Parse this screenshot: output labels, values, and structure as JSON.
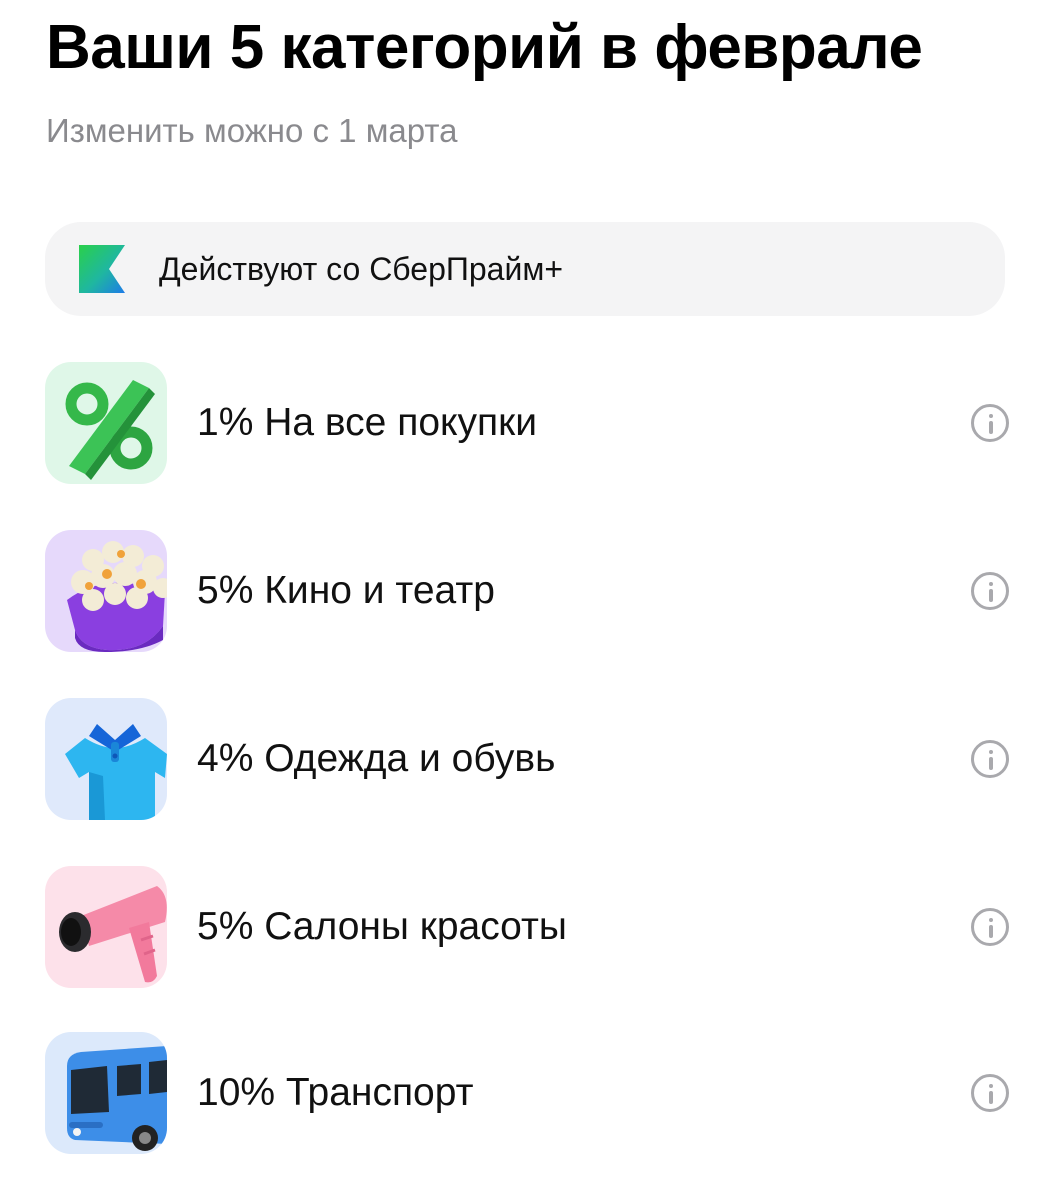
{
  "header": {
    "title": "Ваши 5 категорий в феврале",
    "subtitle": "Изменить можно с 1 марта"
  },
  "banner": {
    "text": "Действуют со СберПрайм+",
    "icon": "sberprime-logo"
  },
  "categories": [
    {
      "label": "1% На все покупки",
      "percent": 1,
      "icon": "percent-icon",
      "bg": "#dff7e8"
    },
    {
      "label": "5% Кино и театр",
      "percent": 5,
      "icon": "popcorn-icon",
      "bg": "#e6d9fb"
    },
    {
      "label": "4% Одежда и обувь",
      "percent": 4,
      "icon": "shirt-icon",
      "bg": "#dfe9fb"
    },
    {
      "label": "5% Салоны красоты",
      "percent": 5,
      "icon": "hairdryer-icon",
      "bg": "#fde1ea"
    },
    {
      "label": "10% Транспорт",
      "percent": 10,
      "icon": "bus-icon",
      "bg": "#dce9fb"
    }
  ],
  "colors": {
    "accent_green": "#21a038",
    "info_icon": "#a9a9ad",
    "subtitle": "#8a8a8e"
  }
}
